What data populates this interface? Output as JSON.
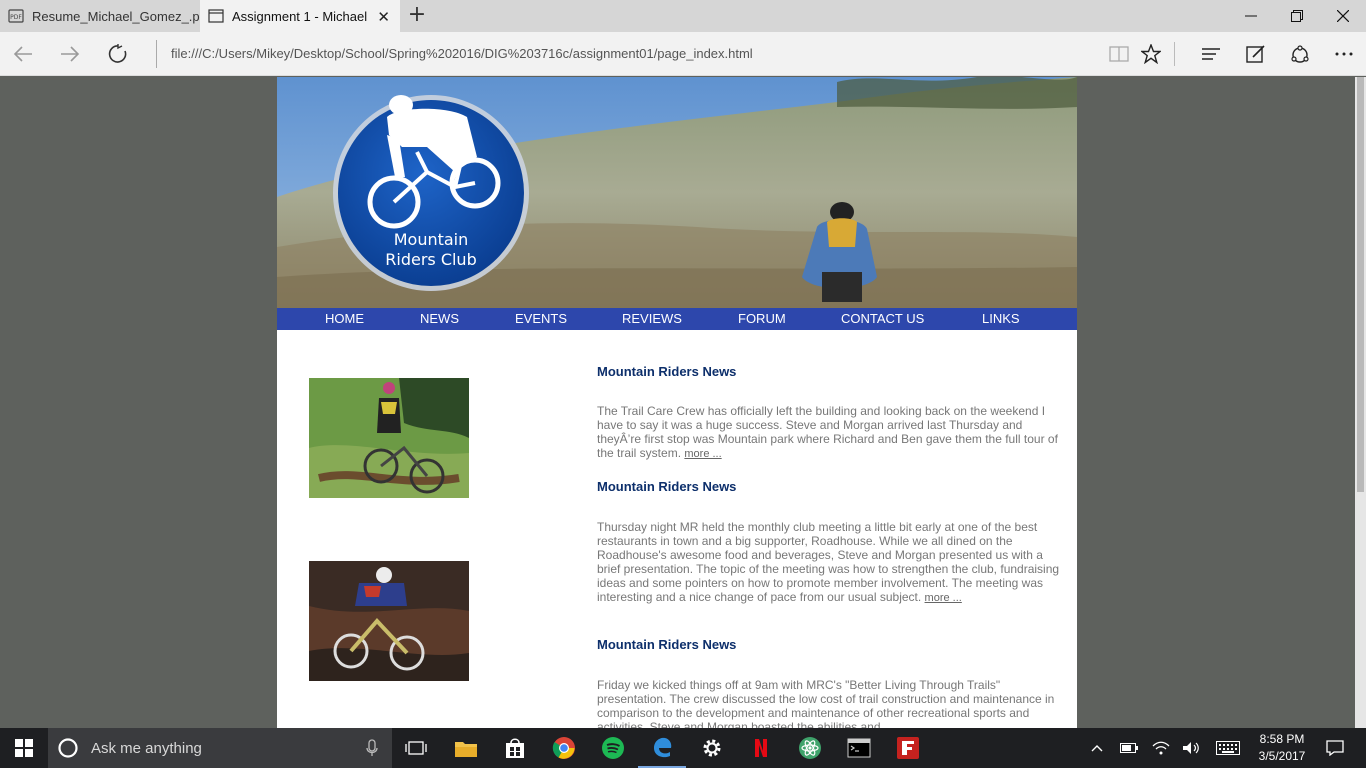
{
  "browser": {
    "tabs": [
      {
        "title": "Resume_Michael_Gomez_.p",
        "icon": "pdf-icon",
        "active": false
      },
      {
        "title": "Assignment 1 - Michael",
        "icon": "page-icon",
        "active": true
      }
    ],
    "address": "file:///C:/Users/Mikey/Desktop/School/Spring%202016/DIG%203716c/assignment01/page_index.html"
  },
  "site": {
    "logo_line1": "Mountain",
    "logo_line2": "Riders Club",
    "menu": [
      "HOME",
      "NEWS",
      "EVENTS",
      "REVIEWS",
      "FORUM",
      "CONTACT US",
      "LINKS"
    ],
    "news": [
      {
        "title": "Mountain Riders News",
        "body": "The Trail Care Crew has officially left the building and looking back on the weekend I have to say it was a huge success. Steve and Morgan arrived last Thursday and theyÂ’re first stop was Mountain park where Richard and Ben gave them the full tour of the trail system.",
        "more": "more ..."
      },
      {
        "title": "Mountain Riders News",
        "body": "Thursday night MR held the monthly club meeting a little bit early at one of the best restaurants in town and a big supporter, Roadhouse. While we all dined on the Roadhouse's awesome food and beverages, Steve and Morgan presented us with a brief presentation. The topic of the meeting was how to strengthen the club, fundraising ideas and some pointers on how to promote member involvement. The meeting was interesting and a nice change of pace from our usual subject.",
        "more": "more ..."
      },
      {
        "title": "Mountain Riders News",
        "body": "Friday we kicked things off at 9am with MRC's \"Better Living Through Trails\" presentation. The crew discussed the low cost of trail construction and maintenance in comparison to the development and maintenance of other recreational sports and activities. Steve and Morgan boasted the abilities and",
        "more": ""
      }
    ]
  },
  "taskbar": {
    "search_placeholder": "Ask me anything",
    "time": "8:58 PM",
    "date": "3/5/2017"
  },
  "colors": {
    "menu_bar": "#2d47ac",
    "news_title": "#0d2f6b",
    "logo_circle": "#1651a8"
  }
}
